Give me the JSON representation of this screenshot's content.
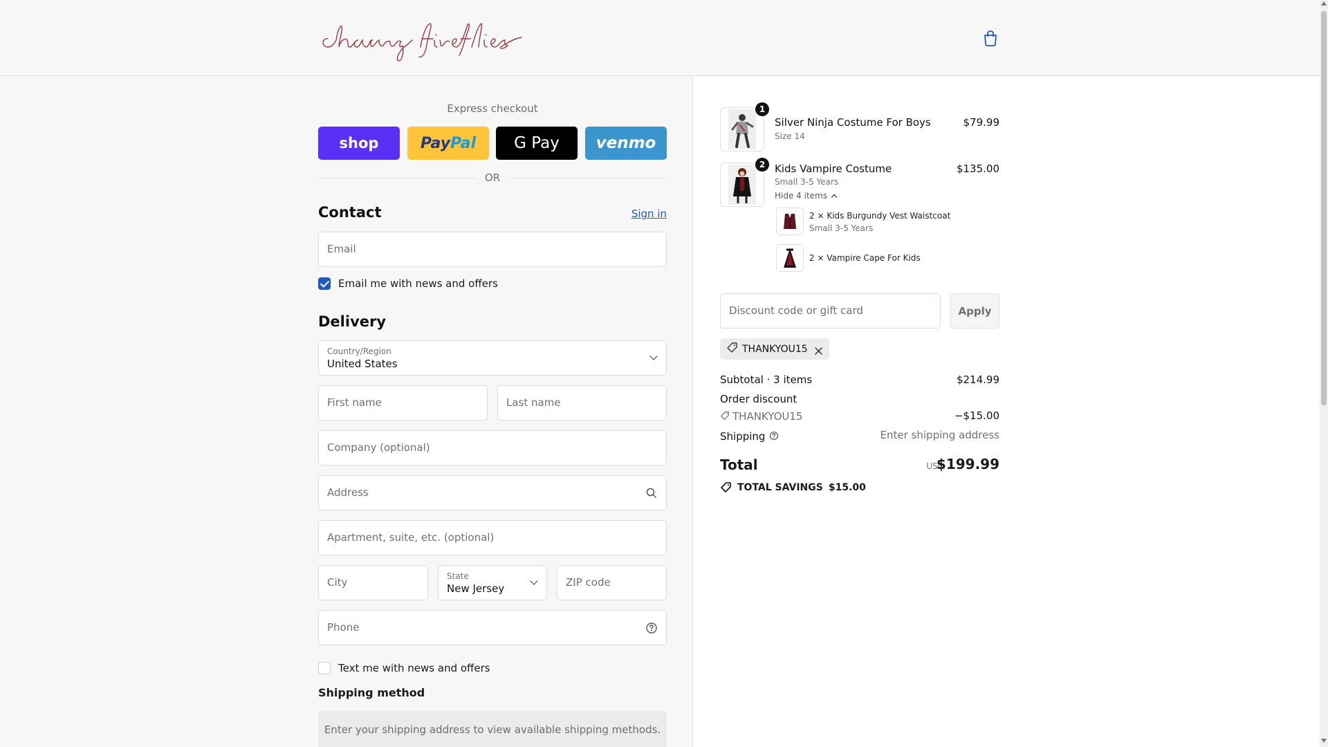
{
  "header": {
    "logo_text": "chasing fireflies",
    "cart_icon": "shopping-bag-icon"
  },
  "express": {
    "label": "Express checkout",
    "buttons": {
      "shop": "shop",
      "paypal_a": "Pay",
      "paypal_b": "Pal",
      "gpay": "G Pay",
      "venmo": "venmo"
    },
    "or": "OR"
  },
  "contact": {
    "title": "Contact",
    "sign_in": "Sign in",
    "email_placeholder": "Email",
    "news_checkbox": {
      "label": "Email me with news and offers",
      "checked": true
    }
  },
  "delivery": {
    "title": "Delivery",
    "country_label": "Country/Region",
    "country_value": "United States",
    "first_name_placeholder": "First name",
    "last_name_placeholder": "Last name",
    "company_placeholder": "Company (optional)",
    "address_placeholder": "Address",
    "apartment_placeholder": "Apartment, suite, etc. (optional)",
    "city_placeholder": "City",
    "state_label": "State",
    "state_value": "New Jersey",
    "zip_placeholder": "ZIP code",
    "phone_placeholder": "Phone",
    "text_checkbox": {
      "label": "Text me with news and offers",
      "checked": false
    }
  },
  "shipping": {
    "title": "Shipping method",
    "note": "Enter your shipping address to view available shipping methods."
  },
  "order": {
    "items": [
      {
        "qty": "1",
        "name": "Silver Ninja Costume For Boys",
        "variant": "Size 14",
        "price": "$79.99"
      },
      {
        "qty": "2",
        "name": "Kids Vampire Costume",
        "variant": "Small 3-5 Years",
        "price": "$135.00",
        "toggle": "Hide 4 items"
      }
    ],
    "subitems": [
      {
        "text": "2 × Kids Burgundy Vest Waistcoat",
        "variant": "Small 3-5 Years"
      },
      {
        "text": "2 × Vampire Cape For Kids"
      }
    ],
    "discount_placeholder": "Discount code or gift card",
    "apply": "Apply",
    "applied_code": "THANKYOU15",
    "subtotal_label": "Subtotal · 3 items",
    "subtotal_value": "$214.99",
    "order_discount_label": "Order discount",
    "discount_code": "THANKYOU15",
    "discount_value": "−$15.00",
    "shipping_label": "Shipping",
    "shipping_value": "Enter shipping address",
    "total_label": "Total",
    "currency": "USD",
    "total_value": "$199.99",
    "savings_label": "TOTAL SAVINGS",
    "savings_value": "$15.00"
  },
  "colors": {
    "accent": "#1f57c3",
    "shop": "#5a31f4",
    "paypal": "#ffc439",
    "venmo": "#3d95ce",
    "logo": "#9c3a46"
  }
}
